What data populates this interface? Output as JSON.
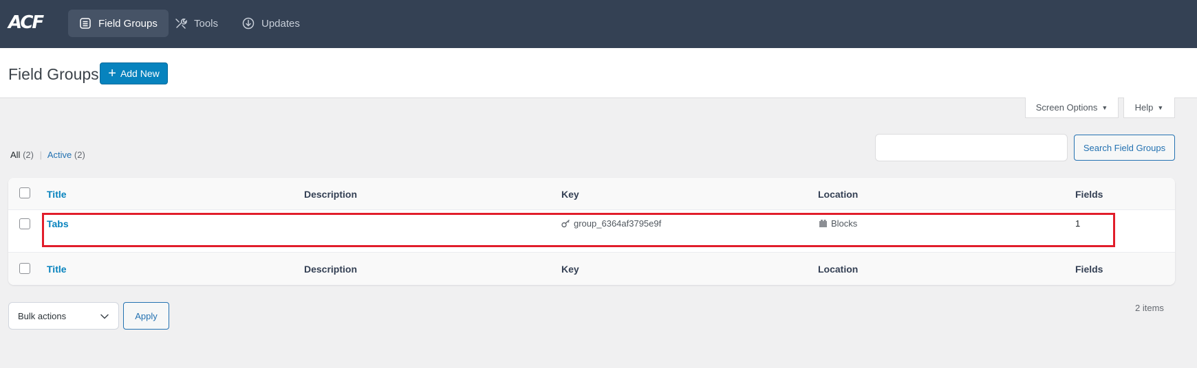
{
  "nav": {
    "logo": "ACF",
    "items": [
      {
        "label": "Field Groups"
      },
      {
        "label": "Tools"
      },
      {
        "label": "Updates"
      }
    ]
  },
  "header": {
    "title": "Field Groups",
    "add_new_label": "Add New"
  },
  "screen_options_label": "Screen Options",
  "help_label": "Help",
  "filters": {
    "all_label": "All",
    "all_count": "(2)",
    "active_label": "Active",
    "active_count": "(2)"
  },
  "search": {
    "value": "",
    "button_label": "Search Field Groups"
  },
  "table": {
    "columns": [
      "Title",
      "Description",
      "Key",
      "Location",
      "Fields"
    ],
    "rows": [
      {
        "title": "Tabs",
        "description": "",
        "key": "group_6364af3795e9f",
        "location": "Blocks",
        "fields": "1"
      }
    ]
  },
  "bulk_actions": {
    "selected": "Bulk actions",
    "apply_label": "Apply"
  },
  "items_count": "2 items",
  "colors": {
    "topbar": "#344154",
    "accent": "#0783be",
    "highlight": "#e11d2a"
  }
}
